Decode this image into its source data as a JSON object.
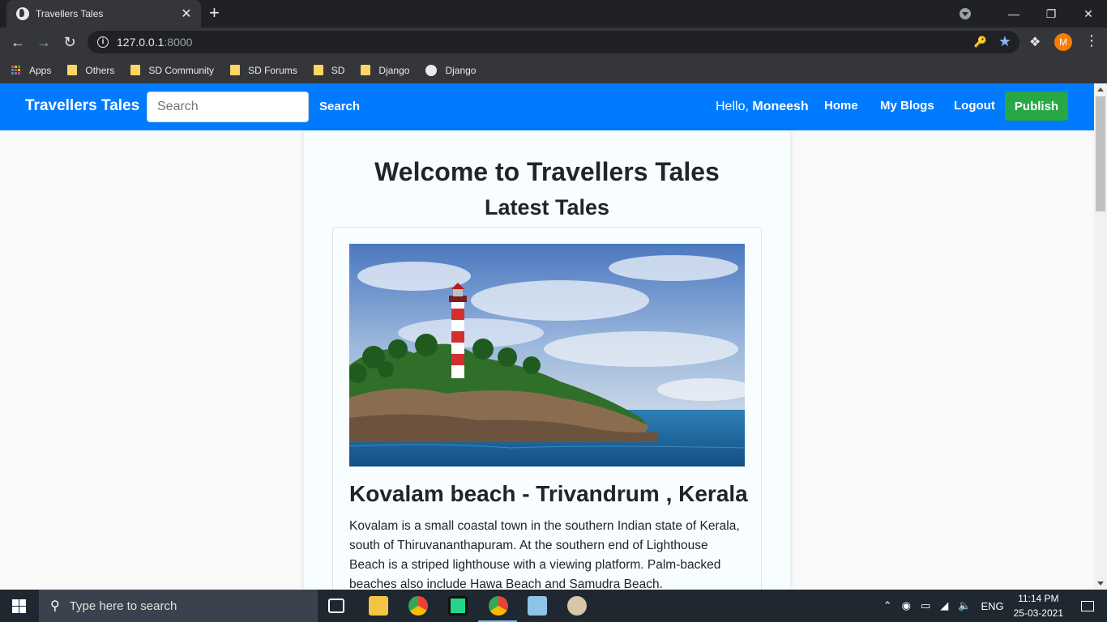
{
  "browser": {
    "tab_title": "Travellers Tales",
    "new_tab": "+",
    "url_host": "127.0.0.1",
    "url_port": ":8000",
    "profile_initial": "M",
    "bookmarks": [
      {
        "label": "Apps",
        "kind": "apps"
      },
      {
        "label": "Others",
        "kind": "folder"
      },
      {
        "label": "SD Community",
        "kind": "folder"
      },
      {
        "label": "SD Forums",
        "kind": "folder"
      },
      {
        "label": "SD",
        "kind": "folder"
      },
      {
        "label": "Django",
        "kind": "folder"
      },
      {
        "label": "Django",
        "kind": "globe"
      }
    ]
  },
  "navbar": {
    "brand": "Travellers Tales",
    "search_placeholder": "Search",
    "search_button": "Search",
    "hello_prefix": "Hello,",
    "username": "Moneesh",
    "links": [
      "Home",
      "My Blogs",
      "Logout"
    ],
    "publish": "Publish"
  },
  "main": {
    "heading": "Welcome to Travellers Tales",
    "subheading": "Latest Tales",
    "post": {
      "title": "Kovalam beach - Trivandrum , Kerala",
      "excerpt": "Kovalam is a small coastal town in the southern Indian state of Kerala, south of Thiruvananthapuram. At the southern end of Lighthouse Beach is a striped lighthouse with a viewing platform. Palm-backed beaches also include Hawa Beach and Samudra Beach."
    }
  },
  "taskbar": {
    "search_placeholder": "Type here to search",
    "language": "ENG",
    "time": "11:14 PM",
    "date": "25-03-2021"
  },
  "colors": {
    "navbar_bg": "#007bff",
    "publish_bg": "#28a745"
  }
}
